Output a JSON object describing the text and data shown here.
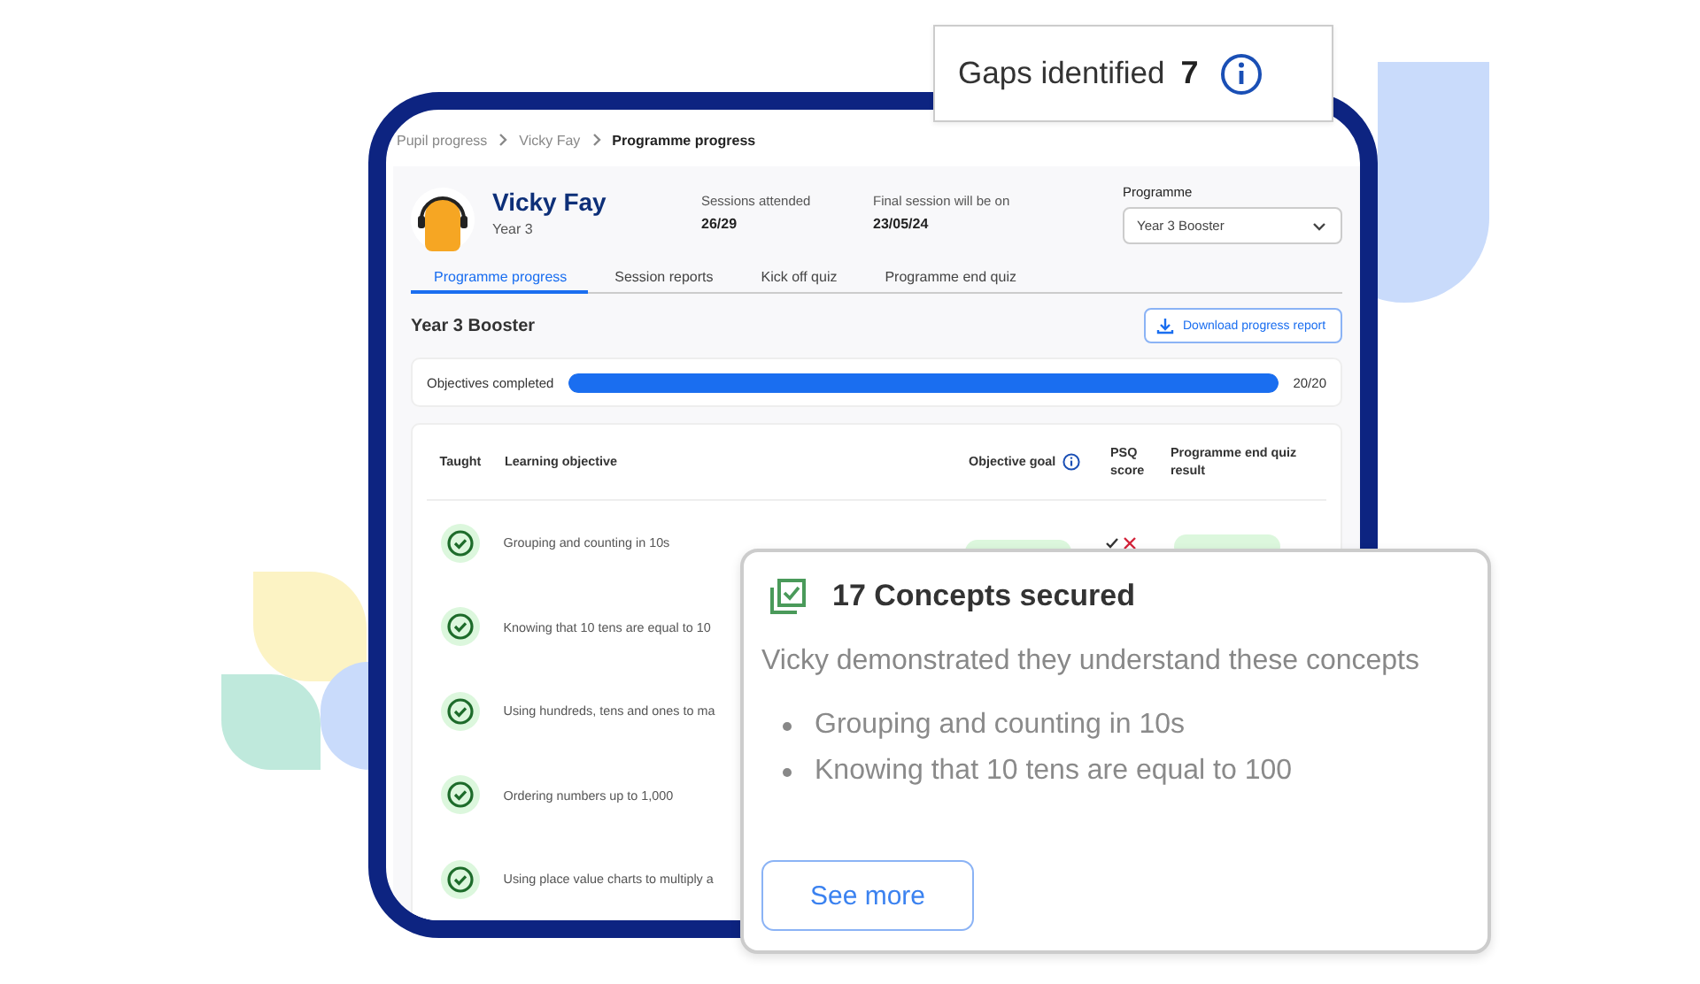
{
  "gaps_card": {
    "label": "Gaps identified",
    "count": "7"
  },
  "breadcrumb": [
    {
      "label": "Pupil progress",
      "current": false
    },
    {
      "label": "Vicky Fay",
      "current": false
    },
    {
      "label": "Programme progress",
      "current": true
    }
  ],
  "pupil": {
    "name": "Vicky Fay",
    "year": "Year 3"
  },
  "stats": [
    {
      "label": "Sessions attended",
      "value": "26/29"
    },
    {
      "label": "Final session will be on",
      "value": "23/05/24"
    }
  ],
  "programme": {
    "label": "Programme",
    "value": "Year 3 Booster"
  },
  "tabs": [
    {
      "label": "Programme progress",
      "selected": true
    },
    {
      "label": "Session reports",
      "selected": false
    },
    {
      "label": "Kick off quiz",
      "selected": false
    },
    {
      "label": "Programme end quiz",
      "selected": false
    }
  ],
  "section": {
    "title": "Year 3 Booster",
    "download_button": "Download progress report"
  },
  "objectives": {
    "label": "Objectives completed",
    "level": 1,
    "reading": "20/20"
  },
  "table": {
    "columns": [
      "Taught",
      "Learning objective",
      "Objective goal",
      "PSQ score",
      "Programme end quiz result"
    ],
    "rows": [
      {
        "taught": true,
        "objective": "Grouping and counting in 10s",
        "goal_tag": true,
        "psq": [
          {
            "correct": true
          },
          {
            "correct": false
          }
        ],
        "result_tag": true
      },
      {
        "taught": true,
        "objective": "Knowing that 10 tens are equal to 10"
      },
      {
        "taught": true,
        "objective": "Using hundreds, tens and ones to ma"
      },
      {
        "taught": true,
        "objective": "Ordering numbers up to 1,000"
      },
      {
        "taught": true,
        "objective": "Using place value charts to multiply a"
      }
    ]
  },
  "concepts_card": {
    "title": "17 Concepts secured",
    "description": "Vicky demonstrated they understand these concepts",
    "items": [
      "Grouping and counting in 10s",
      "Knowing that 10 tens are equal to 100"
    ],
    "button": "See more"
  }
}
